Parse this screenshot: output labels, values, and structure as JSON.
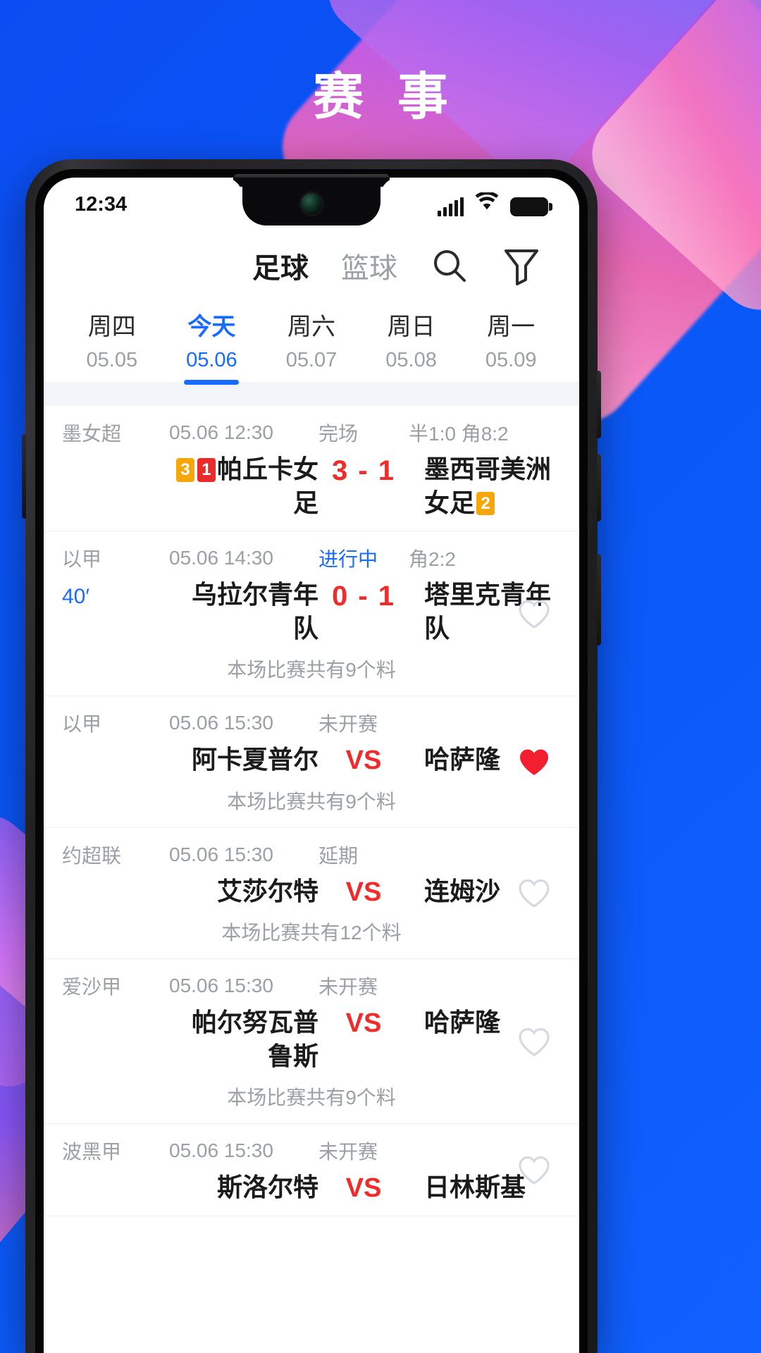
{
  "promo": {
    "title": "赛 事"
  },
  "status_bar": {
    "time": "12:34",
    "signal_icon": "signal-bars-icon",
    "wifi_icon": "wifi-icon",
    "battery_icon": "battery-icon"
  },
  "sport_tabs": {
    "items": [
      {
        "label": "足球",
        "active": true
      },
      {
        "label": "篮球",
        "active": false
      }
    ],
    "search_icon": "search-icon",
    "filter_icon": "filter-icon"
  },
  "date_strip": {
    "items": [
      {
        "day": "周四",
        "date": "05.05",
        "active": false
      },
      {
        "day": "今天",
        "date": "05.06",
        "active": true
      },
      {
        "day": "周六",
        "date": "05.07",
        "active": false
      },
      {
        "day": "周日",
        "date": "05.08",
        "active": false
      },
      {
        "day": "周一",
        "date": "05.09",
        "active": false
      }
    ]
  },
  "matches": [
    {
      "league": "墨女超",
      "time": "05.06 12:30",
      "status": "完场",
      "status_live": false,
      "extra": "半1:0 角8:2",
      "minute": "",
      "home": "帕丘卡女足",
      "home_badges": [
        {
          "text": "3",
          "color": "yellow"
        },
        {
          "text": "1",
          "color": "red"
        }
      ],
      "away": "墨西哥美洲女足",
      "away_badges": [
        {
          "text": "2",
          "color": "yellow"
        }
      ],
      "score": "3 - 1",
      "is_vs": false,
      "note": "",
      "favorite": "none"
    },
    {
      "league": "以甲",
      "time": "05.06 14:30",
      "status": "进行中",
      "status_live": true,
      "extra": "角2:2",
      "minute": "40′",
      "home": "乌拉尔青年队",
      "home_badges": [],
      "away": "塔里克青年队",
      "away_badges": [],
      "score": "0 - 1",
      "is_vs": false,
      "note": "本场比赛共有9个料",
      "favorite": "outline"
    },
    {
      "league": "以甲",
      "time": "05.06 15:30",
      "status": "未开赛",
      "status_live": false,
      "extra": "",
      "minute": "",
      "home": "阿卡夏普尔",
      "home_badges": [],
      "away": "哈萨隆",
      "away_badges": [],
      "score": "VS",
      "is_vs": true,
      "note": "本场比赛共有9个料",
      "favorite": "filled"
    },
    {
      "league": "约超联",
      "time": "05.06 15:30",
      "status": "延期",
      "status_live": false,
      "extra": "",
      "minute": "",
      "home": "艾莎尔特",
      "home_badges": [],
      "away": "连姆沙",
      "away_badges": [],
      "score": "VS",
      "is_vs": true,
      "note": "本场比赛共有12个料",
      "favorite": "outline"
    },
    {
      "league": "爱沙甲",
      "time": "05.06 15:30",
      "status": "未开赛",
      "status_live": false,
      "extra": "",
      "minute": "",
      "home": "帕尔努瓦普鲁斯",
      "home_badges": [],
      "away": "哈萨隆",
      "away_badges": [],
      "score": "VS",
      "is_vs": true,
      "note": "本场比赛共有9个料",
      "favorite": "outline"
    },
    {
      "league": "波黑甲",
      "time": "05.06 15:30",
      "status": "未开赛",
      "status_live": false,
      "extra": "",
      "minute": "",
      "home": "斯洛尔特",
      "home_badges": [],
      "away": "日林斯基",
      "away_badges": [],
      "score": "VS",
      "is_vs": true,
      "note": "",
      "favorite": "outline"
    }
  ],
  "colors": {
    "brand_blue": "#0a57f5",
    "accent_blue": "#176bff",
    "score_red": "#ef2b2b",
    "badge_yellow": "#f6a609",
    "badge_red": "#ea2b2b",
    "heart_red": "#f31e2f",
    "muted": "#9aa0a6"
  }
}
